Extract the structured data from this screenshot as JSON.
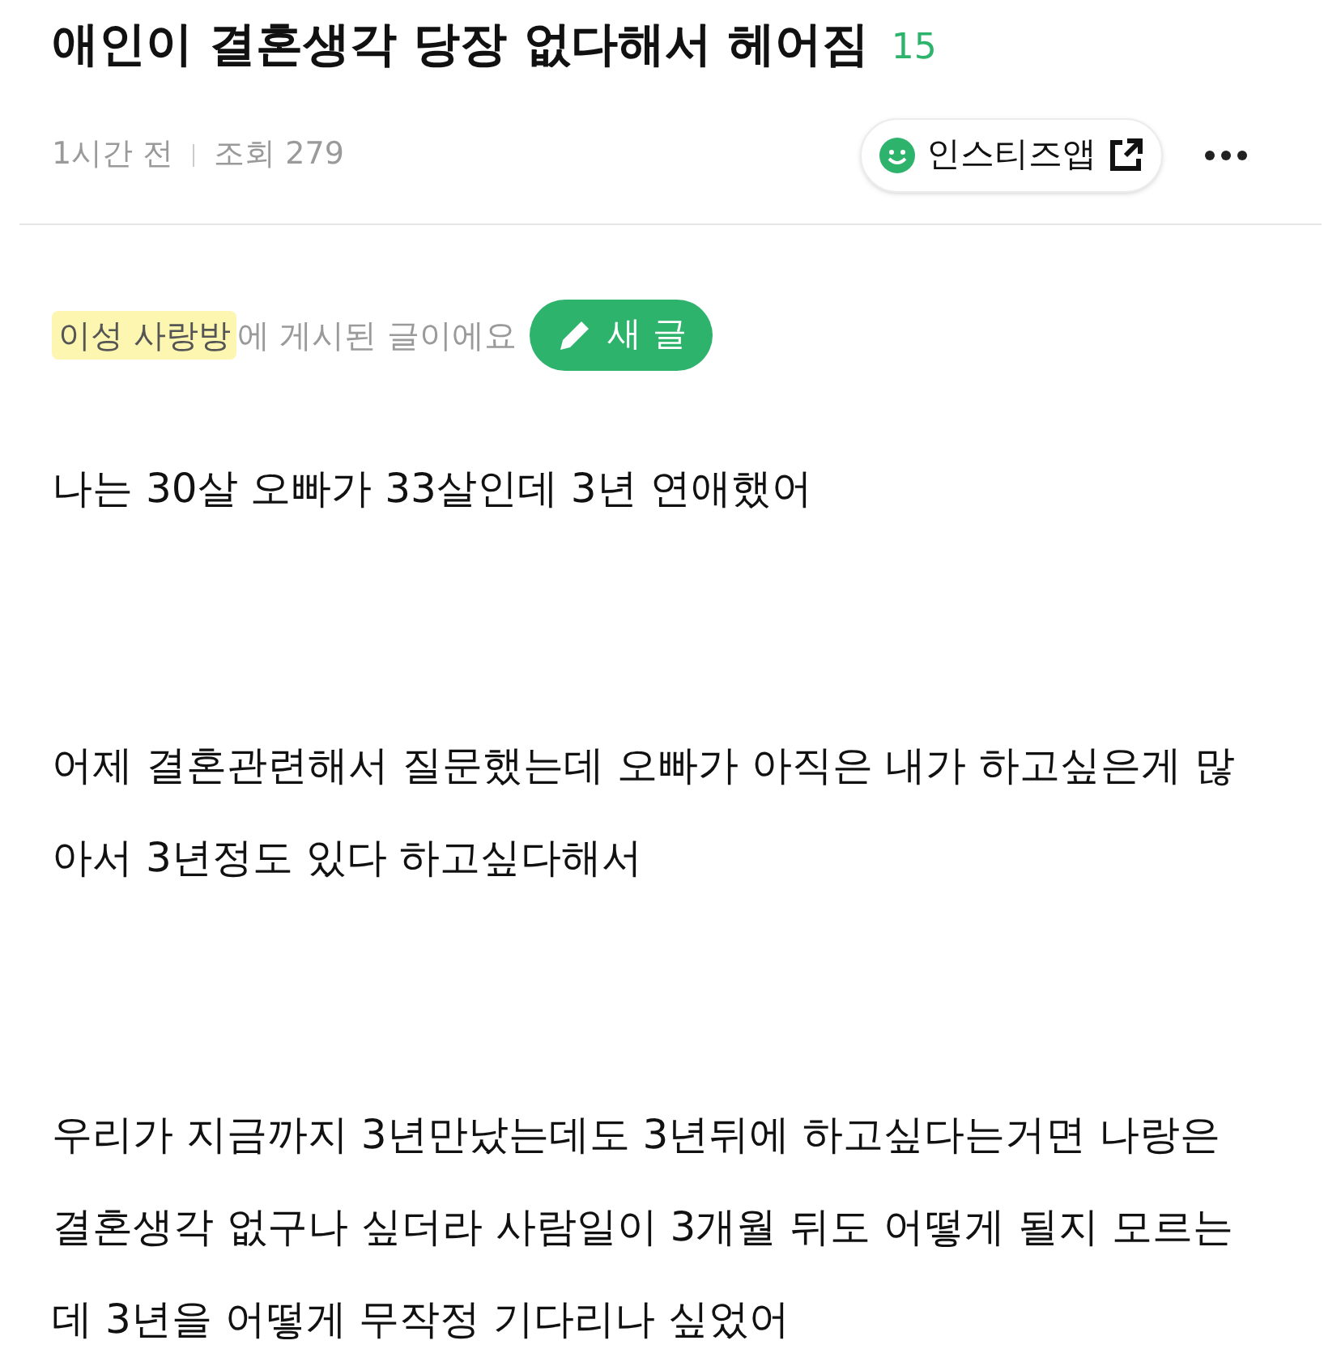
{
  "post": {
    "title": "애인이 결혼생각 당장 없다해서 헤어짐",
    "comment_count": "15"
  },
  "meta": {
    "time": "1시간 전",
    "views": "조회 279",
    "app_button": "인스티즈앱"
  },
  "board": {
    "name": "이성 사랑방",
    "suffix": "에 게시된 글이에요",
    "new_post_button": "새 글"
  },
  "paragraphs": [
    "나는 30살 오빠가 33살인데 3년 연애했어",
    "어제 결혼관련해서 질문했는데 오빠가 아직은 내가 하고싶은게 많아서 3년정도 있다 하고싶다해서",
    "우리가 지금까지 3년만났는데도 3년뒤에 하고싶다는거면 나랑은 결혼생각 없구나 싶더라 사람일이 3개월 뒤도 어떻게 될지 모르는데 3년을 어떻게 무작정 기다리나 싶었어"
  ]
}
